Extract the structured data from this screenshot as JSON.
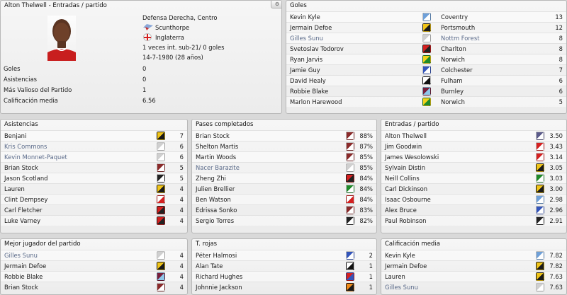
{
  "profile": {
    "title": "Alton Thelwell - Entradas / partido",
    "position": "Defensa Derecha, Centro",
    "club": "Scunthorpe",
    "nation": "Inglaterra",
    "caps": "1 veces int. sub-21/ 0 goles",
    "born": "14-7-1980 (28 años)",
    "stats": [
      {
        "label": "Goles",
        "value": "0"
      },
      {
        "label": "Asistencias",
        "value": "0"
      },
      {
        "label": "Más Valioso del Partido",
        "value": "1"
      },
      {
        "label": "Calificación media",
        "value": "6.56"
      }
    ],
    "gear_icon": "gear-icon"
  },
  "goles": {
    "title": "Goles",
    "rows": [
      {
        "name": "Kevin Kyle",
        "club": "Coventry",
        "value": "13",
        "kit": [
          "#6fa0d8",
          "#ffffff"
        ],
        "hl": false
      },
      {
        "name": "Jermain Defoe",
        "club": "Portsmouth",
        "value": "12",
        "kit": [
          "#f0c419",
          "#1a1a1a"
        ],
        "hl": false
      },
      {
        "name": "Gilles Sunu",
        "club": "Nottm Forest",
        "value": "8",
        "kit": [
          "#cfcfcf",
          "#ffffff"
        ],
        "hl": true
      },
      {
        "name": "Svetoslav Todorov",
        "club": "Charlton",
        "value": "8",
        "kit": [
          "#d42020",
          "#222222"
        ],
        "hl": false
      },
      {
        "name": "Ryan Jarvis",
        "club": "Norwich",
        "value": "8",
        "kit": [
          "#f2d21a",
          "#1f8a2a"
        ],
        "hl": false
      },
      {
        "name": "Jamie Guy",
        "club": "Colchester",
        "value": "7",
        "kit": [
          "#3355bb",
          "#ffffff"
        ],
        "hl": false
      },
      {
        "name": "David Healy",
        "club": "Fulham",
        "value": "6",
        "kit": [
          "#ffffff",
          "#111111"
        ],
        "hl": false
      },
      {
        "name": "Robbie Blake",
        "club": "Burnley",
        "value": "6",
        "kit": [
          "#7a1e3a",
          "#8ec7ea"
        ],
        "hl": false
      },
      {
        "name": "Marlon Harewood",
        "club": "Norwich",
        "value": "5",
        "kit": [
          "#f2d21a",
          "#1f8a2a"
        ],
        "hl": false
      }
    ]
  },
  "asistencias": {
    "title": "Asistencias",
    "rows": [
      {
        "name": "Benjani",
        "value": "7",
        "kit": [
          "#f0c419",
          "#1a1a1a"
        ],
        "hl": false
      },
      {
        "name": "Kris Commons",
        "value": "6",
        "kit": [
          "#cfcfcf",
          "#ffffff"
        ],
        "hl": true
      },
      {
        "name": "Kevin Monnet-Paquet",
        "value": "6",
        "kit": [
          "#cfcfcf",
          "#ffffff"
        ],
        "hl": true
      },
      {
        "name": "Brian Stock",
        "value": "5",
        "kit": [
          "#8a2a2a",
          "#ffffff"
        ],
        "hl": false
      },
      {
        "name": "Jason Scotland",
        "value": "5",
        "kit": [
          "#222222",
          "#ffffff"
        ],
        "hl": false
      },
      {
        "name": "Lauren",
        "value": "4",
        "kit": [
          "#f0c419",
          "#1a1a1a"
        ],
        "hl": false
      },
      {
        "name": "Clint Dempsey",
        "value": "4",
        "kit": [
          "#ffffff",
          "#d42020"
        ],
        "hl": false
      },
      {
        "name": "Carl Fletcher",
        "value": "4",
        "kit": [
          "#d42020",
          "#222222"
        ],
        "hl": false
      },
      {
        "name": "Luke Varney",
        "value": "4",
        "kit": [
          "#d42020",
          "#222222"
        ],
        "hl": false
      }
    ]
  },
  "pases": {
    "title": "Pases completados",
    "rows": [
      {
        "name": "Brian Stock",
        "value": "88%",
        "kit": [
          "#8a2a2a",
          "#ffffff"
        ],
        "hl": false
      },
      {
        "name": "Shelton Martis",
        "value": "87%",
        "kit": [
          "#8a2a2a",
          "#ffffff"
        ],
        "hl": false
      },
      {
        "name": "Martin Woods",
        "value": "85%",
        "kit": [
          "#8a2a2a",
          "#ffffff"
        ],
        "hl": false
      },
      {
        "name": "Nacer Barazite",
        "value": "85%",
        "kit": [
          "#cfcfcf",
          "#ffffff"
        ],
        "hl": true
      },
      {
        "name": "Zheng Zhi",
        "value": "84%",
        "kit": [
          "#d42020",
          "#222222"
        ],
        "hl": false
      },
      {
        "name": "Julien Brellier",
        "value": "84%",
        "kit": [
          "#1f8a2a",
          "#ffffff"
        ],
        "hl": false
      },
      {
        "name": "Ben Watson",
        "value": "84%",
        "kit": [
          "#ffffff",
          "#d42020"
        ],
        "hl": false
      },
      {
        "name": "Edrissa Sonko",
        "value": "83%",
        "kit": [
          "#8a2a2a",
          "#ffffff"
        ],
        "hl": false
      },
      {
        "name": "Sergio Torres",
        "value": "82%",
        "kit": [
          "#222222",
          "#ffffff"
        ],
        "hl": false
      }
    ]
  },
  "entradas": {
    "title": "Entradas / partido",
    "rows": [
      {
        "name": "Alton Thelwell",
        "value": "3.50",
        "kit": [
          "#5a5a8a",
          "#ffffff"
        ],
        "hl": false
      },
      {
        "name": "Jim Goodwin",
        "value": "3.43",
        "kit": [
          "#d42020",
          "#ffffff"
        ],
        "hl": false
      },
      {
        "name": "James Wesolowski",
        "value": "3.14",
        "kit": [
          "#d42020",
          "#ffffff"
        ],
        "hl": false
      },
      {
        "name": "Sylvain Distin",
        "value": "3.05",
        "kit": [
          "#f0c419",
          "#1a1a1a"
        ],
        "hl": false
      },
      {
        "name": "Neill Collins",
        "value": "3.03",
        "kit": [
          "#1f8a2a",
          "#ffffff"
        ],
        "hl": false
      },
      {
        "name": "Carl Dickinson",
        "value": "3.00",
        "kit": [
          "#f0c419",
          "#1a1a1a"
        ],
        "hl": false
      },
      {
        "name": "Isaac Osbourne",
        "value": "2.98",
        "kit": [
          "#6fa0d8",
          "#ffffff"
        ],
        "hl": false
      },
      {
        "name": "Alex Bruce",
        "value": "2.96",
        "kit": [
          "#3355bb",
          "#ffffff"
        ],
        "hl": false
      },
      {
        "name": "Paul Robinson",
        "value": "2.91",
        "kit": [
          "#222222",
          "#ffffff"
        ],
        "hl": false
      }
    ]
  },
  "mejor": {
    "title": "Mejor jugador del partido",
    "rows": [
      {
        "name": "Gilles Sunu",
        "value": "4",
        "kit": [
          "#cfcfcf",
          "#ffffff"
        ],
        "hl": true
      },
      {
        "name": "Jermain Defoe",
        "value": "4",
        "kit": [
          "#f0c419",
          "#1a1a1a"
        ],
        "hl": false
      },
      {
        "name": "Robbie Blake",
        "value": "4",
        "kit": [
          "#7a1e3a",
          "#8ec7ea"
        ],
        "hl": false
      },
      {
        "name": "Brian Stock",
        "value": "4",
        "kit": [
          "#8a2a2a",
          "#ffffff"
        ],
        "hl": false
      }
    ]
  },
  "rojas": {
    "title": "T. rojas",
    "rows": [
      {
        "name": "Péter Halmosi",
        "value": "2",
        "kit": [
          "#3355bb",
          "#ffffff"
        ],
        "hl": false
      },
      {
        "name": "Alan Tate",
        "value": "1",
        "kit": [
          "#ffffff",
          "#111111"
        ],
        "hl": false
      },
      {
        "name": "Richard Hughes",
        "value": "1",
        "kit": [
          "#d42020",
          "#3355bb"
        ],
        "hl": false
      },
      {
        "name": "Johnnie Jackson",
        "value": "1",
        "kit": [
          "#f08a19",
          "#1a1a1a"
        ],
        "hl": false
      }
    ]
  },
  "calificacion": {
    "title": "Calificación media",
    "rows": [
      {
        "name": "Kevin Kyle",
        "value": "7.82",
        "kit": [
          "#6fa0d8",
          "#ffffff"
        ],
        "hl": false
      },
      {
        "name": "Jermain Defoe",
        "value": "7.82",
        "kit": [
          "#f0c419",
          "#1a1a1a"
        ],
        "hl": false
      },
      {
        "name": "Lauren",
        "value": "7.63",
        "kit": [
          "#f0c419",
          "#1a1a1a"
        ],
        "hl": false
      },
      {
        "name": "Gilles Sunu",
        "value": "7.63",
        "kit": [
          "#cfcfcf",
          "#ffffff"
        ],
        "hl": true
      }
    ]
  }
}
